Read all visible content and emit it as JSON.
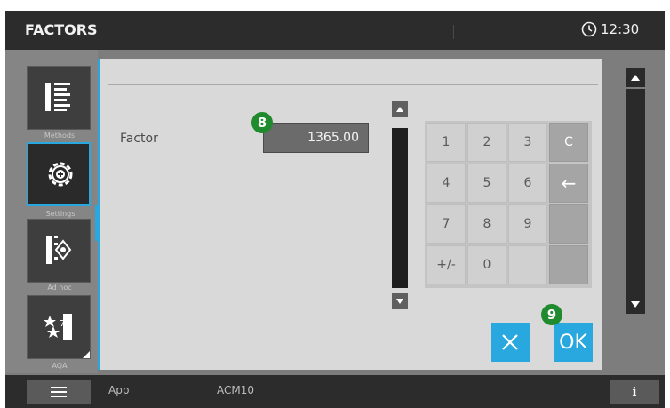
{
  "header": {
    "title": "FACTORS",
    "time": "12:30"
  },
  "nav": {
    "items": [
      {
        "label": "Methods",
        "icon": "methods-list-icon"
      },
      {
        "label": "Settings",
        "icon": "settings-gear-icon",
        "active": true
      },
      {
        "label": "Ad hoc",
        "icon": "ad-hoc-icon"
      },
      {
        "label": "AQA",
        "icon": "aqa-stars-icon"
      }
    ]
  },
  "dialog": {
    "factor_label": "Factor",
    "factor_value": "1365.00",
    "keypad": [
      "1",
      "2",
      "3",
      "C",
      "4",
      "5",
      "6",
      "←",
      "7",
      "8",
      "9",
      "",
      "+/-",
      "0",
      "",
      ""
    ],
    "cancel_icon": "close-icon",
    "ok_label": "OK"
  },
  "badges": {
    "factor": "8",
    "ok": "9"
  },
  "footer": {
    "app": "App",
    "instrument": "ACM10",
    "info": "i"
  },
  "colors": {
    "accent": "#29a8df",
    "badge": "#1f8a2e",
    "background": "#7d7d7d",
    "bar": "#2c2c2c"
  }
}
